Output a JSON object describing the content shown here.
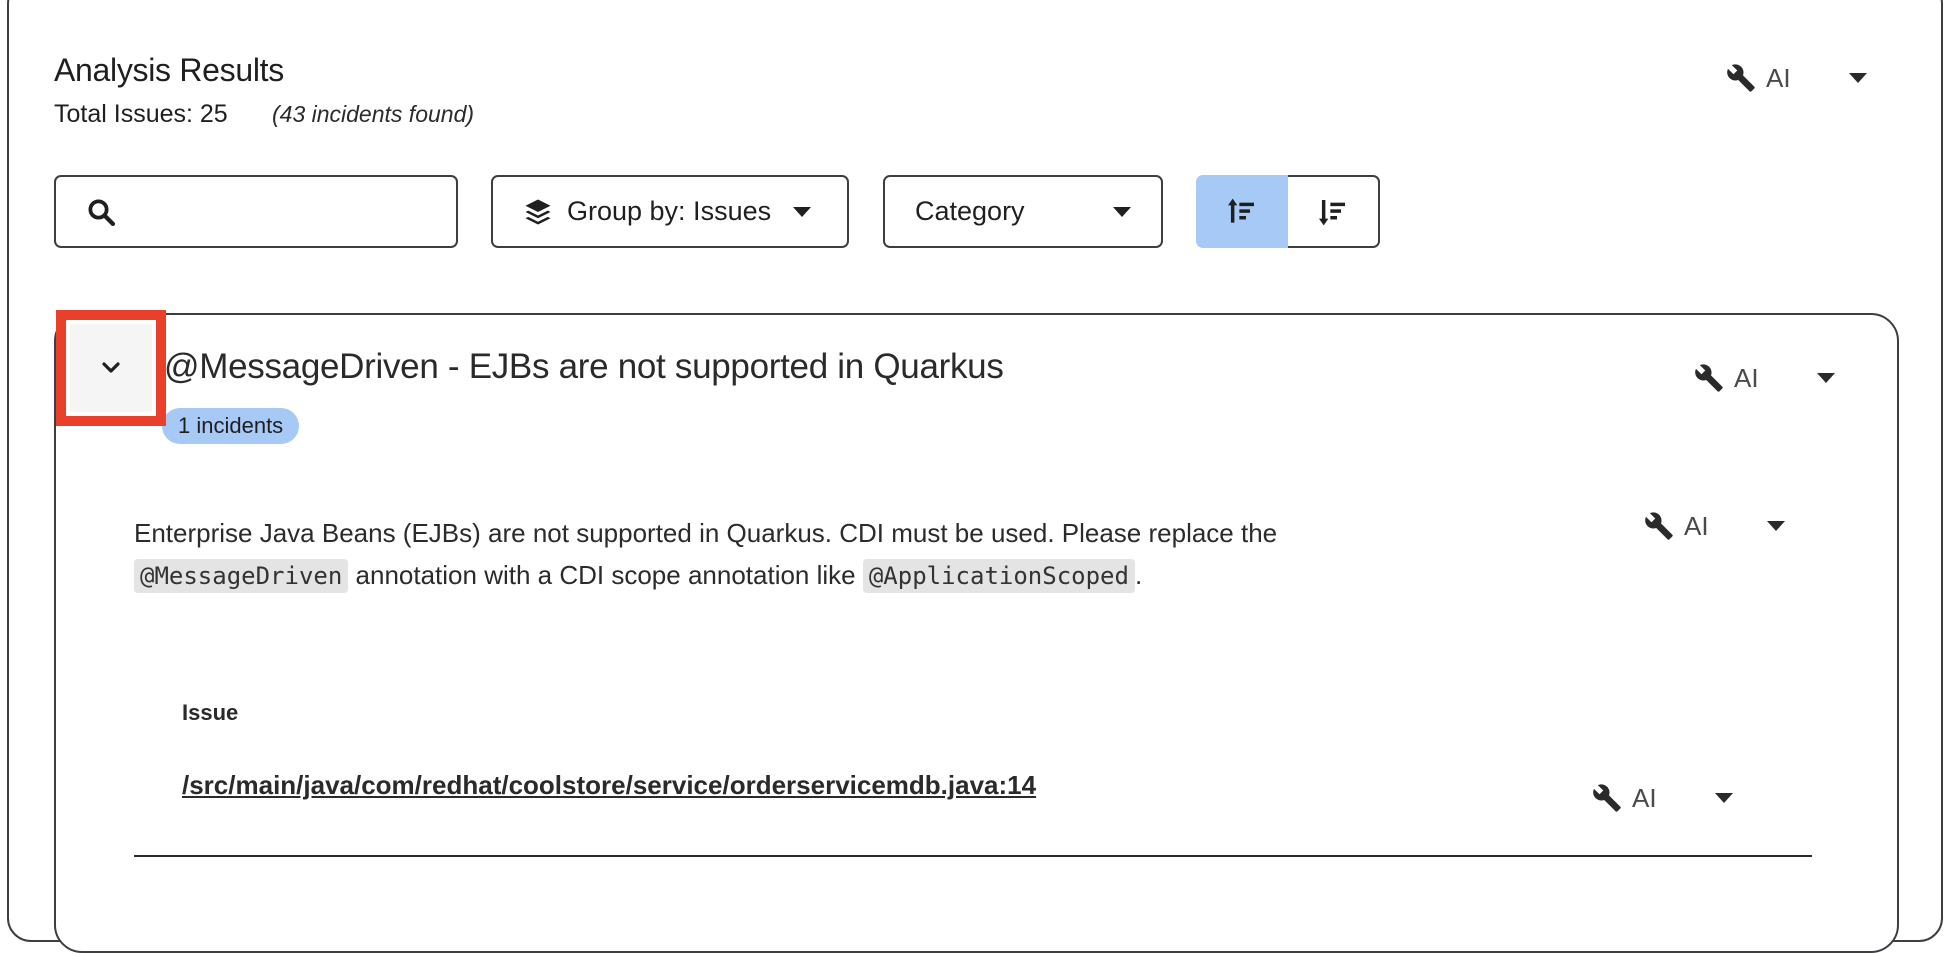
{
  "header": {
    "title": "Analysis Results",
    "total_issues": "Total Issues: 25",
    "incidents_found": "(43 incidents found)"
  },
  "ai_action": {
    "label": "AI",
    "icon": "wrench-icon"
  },
  "toolbar": {
    "search": {
      "placeholder": "",
      "value": "",
      "icon": "search-icon"
    },
    "group_by": {
      "label": "Group by: Issues",
      "icon": "layers-icon"
    },
    "category": {
      "label": "Category"
    },
    "sort": {
      "ascending_icon": "sort-ascending-icon",
      "descending_icon": "sort-descending-icon",
      "active": "ascending"
    }
  },
  "issue": {
    "title": "@MessageDriven - EJBs are not supported in Quarkus",
    "badge": "1 incidents",
    "description": {
      "part1": "Enterprise Java Beans (EJBs) are not supported in Quarkus. CDI must be used. Please replace the",
      "code1": "@MessageDriven",
      "part2": "annotation with a CDI scope annotation like",
      "code2": "@ApplicationScoped",
      "part3": "."
    },
    "incidents_heading": "Issue",
    "incidents": [
      {
        "path": "/src/main/java/com/redhat/coolstore/service/orderservicemdb.java:14"
      }
    ]
  },
  "colors": {
    "accent_blue": "#a7c9f5",
    "highlight_red": "#e8402b",
    "border": "#3c3f42"
  }
}
